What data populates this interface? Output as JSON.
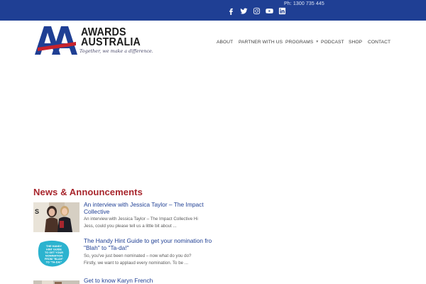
{
  "topbar": {
    "phone": "Ph: 1300 735 445",
    "social": [
      {
        "icon": "facebook-icon"
      },
      {
        "icon": "twitter-icon"
      },
      {
        "icon": "instagram-icon"
      },
      {
        "icon": "youtube-icon"
      },
      {
        "icon": "linkedin-icon"
      }
    ],
    "color": "#1f3f94"
  },
  "logo": {
    "word1": "AWARDS",
    "word2": "AUSTRALIA",
    "tagline": "Together, we make a difference."
  },
  "nav": {
    "items": [
      {
        "label": "ABOUT",
        "dropdown": false
      },
      {
        "label": "PARTNER WITH US",
        "dropdown": false
      },
      {
        "label": "PROGRAMS",
        "dropdown": true
      },
      {
        "label": "PODCAST",
        "dropdown": false
      },
      {
        "label": "SHOP",
        "dropdown": false
      },
      {
        "label": "CONTACT",
        "dropdown": false
      }
    ]
  },
  "news": {
    "title": "News & Announcements",
    "posts": [
      {
        "title_lines": [
          "An interview with Jessica Taylor – The Impact",
          "Collective"
        ],
        "excerpt_lines": [
          "An interview with Jessica Taylor – The Impact Collective Hi",
          "Jess, could you please tell us a little bit about ..."
        ]
      },
      {
        "thumb_text": "THE HANDY HINT GUIDE TO GET YOUR NOMINATION FROM \"BLAH\" TO \"TA-DA!\"",
        "title_lines": [
          "The Handy Hint Guide to get your nomination fro",
          "\"Blah\" to \"Ta-da!\""
        ],
        "excerpt_lines": [
          "So, you've just been nominated – now what do you do?",
          "Firstly, we want to applaud every nomination. To be ..."
        ]
      },
      {
        "title_lines": [
          "Get to know Karyn French"
        ],
        "excerpt_lines": []
      }
    ]
  },
  "colors": {
    "brand_blue": "#1f3f94",
    "brand_red": "#a8262d",
    "link_blue": "#1f3f94"
  }
}
